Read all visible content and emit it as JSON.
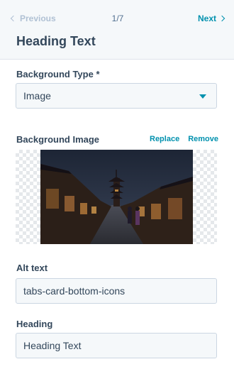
{
  "pager": {
    "previous_label": "Previous",
    "count": "1/7",
    "next_label": "Next"
  },
  "panel": {
    "title": "Heading Text"
  },
  "background_type": {
    "label": "Background Type *",
    "value": "Image"
  },
  "background_image": {
    "label": "Background Image",
    "replace_label": "Replace",
    "remove_label": "Remove"
  },
  "alt_text": {
    "label": "Alt text",
    "value": "tabs-card-bottom-icons"
  },
  "heading": {
    "label": "Heading",
    "value": "Heading Text"
  },
  "colors": {
    "accent": "#0091ae",
    "text": "#33475b",
    "disabled": "#b0c1d4",
    "border": "#cbd6e2"
  }
}
